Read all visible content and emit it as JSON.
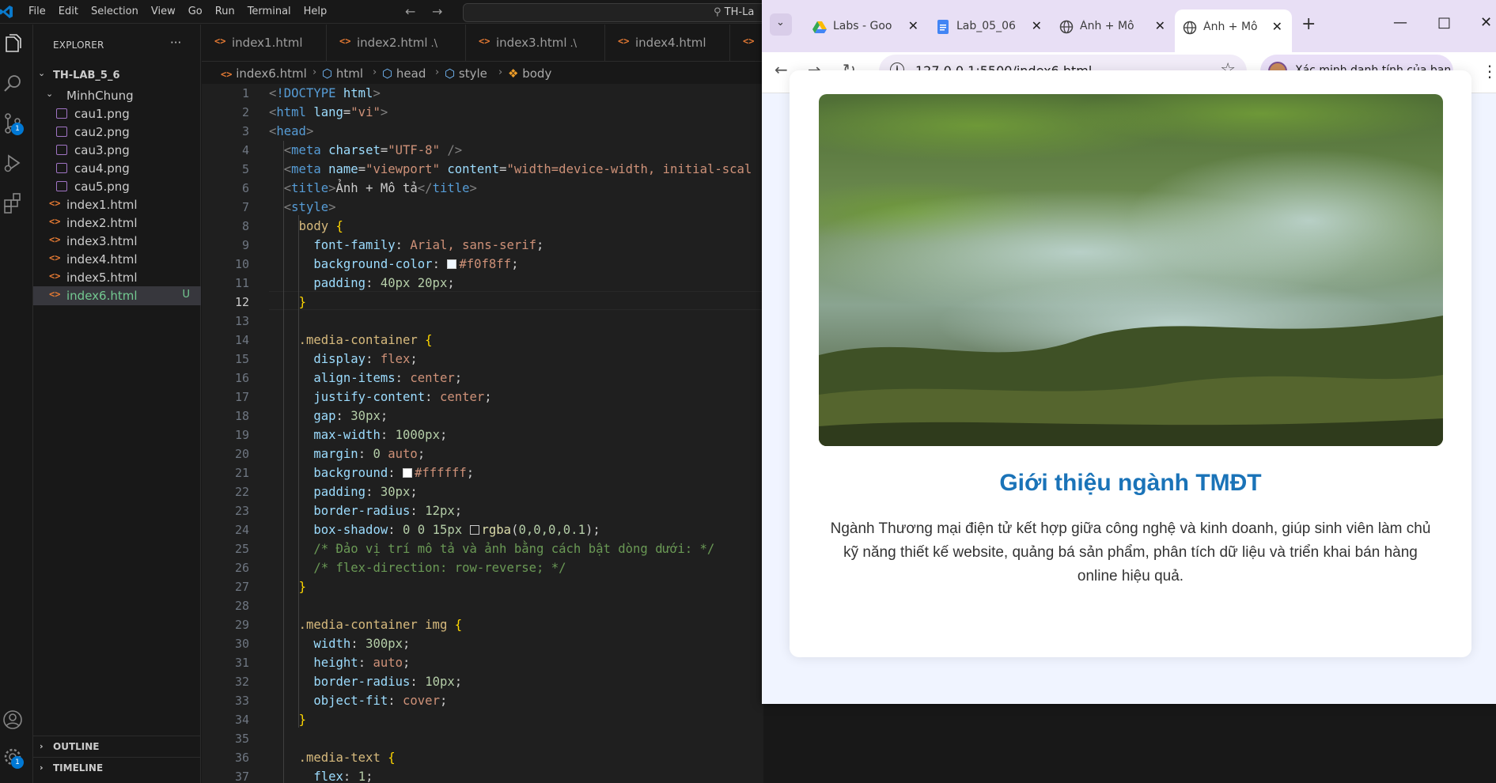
{
  "vscode": {
    "menu": [
      "File",
      "Edit",
      "Selection",
      "View",
      "Go",
      "Run",
      "Terminal",
      "Help"
    ],
    "search_text": "TH-La",
    "explorer": {
      "title": "EXPLORER",
      "root": "TH-LAB_5_6",
      "folder": "MinhChung",
      "images": [
        "cau1.png",
        "cau2.png",
        "cau3.png",
        "cau4.png",
        "cau5.png"
      ],
      "files": [
        "index1.html",
        "index2.html",
        "index3.html",
        "index4.html",
        "index5.html",
        "index6.html"
      ],
      "active_file_badge": "U",
      "outline": "OUTLINE",
      "timeline": "TIMELINE"
    },
    "badges": {
      "source_control": "1",
      "accounts": "1"
    },
    "tabs": [
      {
        "label": "index1.html",
        "suffix": ""
      },
      {
        "label": "index2.html",
        "suffix": ".\\"
      },
      {
        "label": "index3.html",
        "suffix": ".\\"
      },
      {
        "label": "index4.html",
        "suffix": ""
      }
    ],
    "breadcrumb": [
      "index6.html",
      "html",
      "head",
      "style",
      "body"
    ],
    "current_line": 12,
    "line_numbers": [
      "1",
      "2",
      "3",
      "4",
      "5",
      "6",
      "7",
      "8",
      "9",
      "10",
      "11",
      "12",
      "13",
      "14",
      "15",
      "16",
      "17",
      "18",
      "19",
      "20",
      "21",
      "22",
      "23",
      "24",
      "25",
      "26",
      "27",
      "28",
      "29",
      "30",
      "31",
      "32",
      "33",
      "34",
      "35",
      "36",
      "37"
    ]
  },
  "browser": {
    "tabs": [
      {
        "label": "Labs - Goo",
        "favicon": "drive-icon"
      },
      {
        "label": "Lab_05_06",
        "favicon": "docs-icon"
      },
      {
        "label": "Ảnh + Mô",
        "favicon": "globe-icon"
      },
      {
        "label": "Ảnh + Mô",
        "favicon": "globe-icon"
      }
    ],
    "url": "127.0.0.1:5500/index6.html",
    "profile_label": "Xác minh danh tính của bạn",
    "page": {
      "title": "Giới thiệu ngành TMĐT",
      "description": "Ngành Thương mại điện tử kết hợp giữa công nghệ và kinh doanh, giúp sinh viên làm chủ kỹ năng thiết kế website, quảng bá sản phẩm, phân tích dữ liệu và triển khai bán hàng online hiệu quả."
    }
  },
  "colors": {
    "accent": "#1a73b8",
    "editor_bg": "#1f1f1f",
    "page_bg": "#f0f4ff"
  }
}
